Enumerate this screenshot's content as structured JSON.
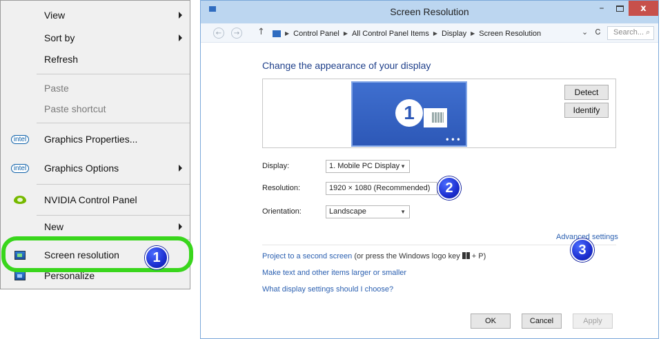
{
  "context_menu": {
    "items": [
      {
        "label": "View"
      },
      {
        "label": "Sort by"
      },
      {
        "label": "Refresh"
      },
      {
        "label": "Paste"
      },
      {
        "label": "Paste shortcut"
      },
      {
        "label": "Graphics Properties..."
      },
      {
        "label": "Graphics Options"
      },
      {
        "label": "NVIDIA Control Panel"
      },
      {
        "label": "New"
      },
      {
        "label": "Screen resolution"
      },
      {
        "label": "Personalize"
      }
    ],
    "intel_logo_text": "intel"
  },
  "callouts": [
    "1",
    "2",
    "3"
  ],
  "window": {
    "title": "Screen Resolution",
    "minimize": "–",
    "close": "x",
    "nav": {
      "back": "←",
      "forward": "→",
      "up": "↑",
      "breadcrumb": [
        "Control Panel",
        "All Control Panel Items",
        "Display",
        "Screen Resolution"
      ],
      "dropdown": "⌄",
      "refresh": "Ꮯ",
      "search_placeholder": "Search... ⌕"
    },
    "heading": "Change the appearance of your display",
    "monitor_number": "1",
    "monitor_dots": "•••",
    "detect_label": "Detect",
    "identify_label": "Identify",
    "display": {
      "label": "Display:",
      "value": "1. Mobile PC Display"
    },
    "resolution": {
      "label": "Resolution:",
      "value": "1920 × 1080 (Recommended)"
    },
    "orientation": {
      "label": "Orientation:",
      "value": "Landscape"
    },
    "advanced_settings": "Advanced settings",
    "project_link": "Project to a second screen",
    "project_suffix_a": "(or press the Windows logo key",
    "project_suffix_b": "+ P)",
    "text_size_link": "Make text and other items larger or smaller",
    "help_link": "What display settings should I choose?",
    "ok_label": "OK",
    "cancel_label": "Cancel",
    "apply_label": "Apply"
  },
  "colors": {
    "highlight": "#39d61c",
    "badge": "#1d2fd0",
    "link": "#2a5fb0"
  }
}
